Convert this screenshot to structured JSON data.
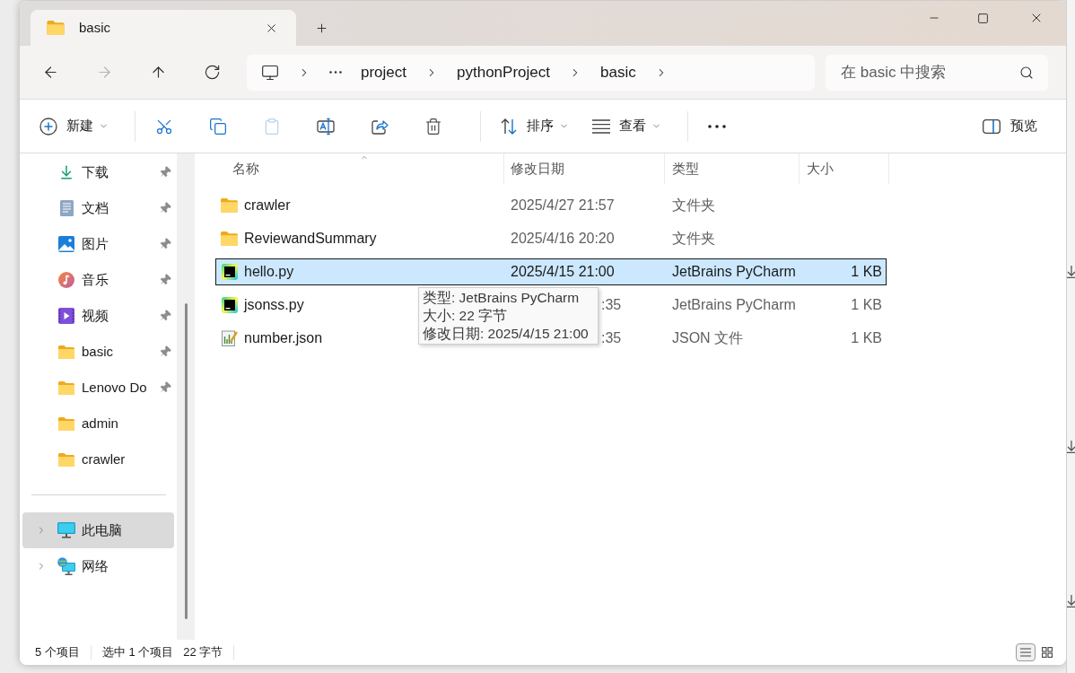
{
  "tabs": [
    {
      "label": "basic",
      "selected": true
    }
  ],
  "nav_buttons": [
    {
      "kind": "back",
      "disabled": false
    },
    {
      "kind": "forward",
      "disabled": true
    },
    {
      "kind": "up",
      "disabled": false
    },
    {
      "kind": "refresh",
      "disabled": false
    }
  ],
  "address_bar": {
    "crumbs": [
      "project",
      "pythonProject",
      "basic"
    ]
  },
  "search": {
    "placeholder": "在 basic 中搜索"
  },
  "toolbar": {
    "items": [
      {
        "kind": "new",
        "label": "新建",
        "disabled": false
      },
      {
        "kind": "separator"
      },
      {
        "kind": "cut",
        "disabled": false
      },
      {
        "kind": "copy",
        "disabled": false
      },
      {
        "kind": "paste",
        "disabled": true
      },
      {
        "kind": "rename",
        "disabled": false
      },
      {
        "kind": "share",
        "disabled": false
      },
      {
        "kind": "delete",
        "disabled": false
      },
      {
        "kind": "separator"
      },
      {
        "kind": "sort",
        "label": "排序",
        "disabled": false
      },
      {
        "kind": "view",
        "label": "查看",
        "disabled": false
      },
      {
        "kind": "separator"
      },
      {
        "kind": "more",
        "disabled": false
      }
    ],
    "preview": {
      "label": "预览"
    }
  },
  "sidebar": {
    "quick_access": [
      {
        "kind": "downloads",
        "label": "下载",
        "pinned": true,
        "selected": false
      },
      {
        "kind": "documents",
        "label": "文档",
        "pinned": true,
        "selected": false
      },
      {
        "kind": "pictures",
        "label": "图片",
        "pinned": true,
        "selected": false
      },
      {
        "kind": "music",
        "label": "音乐",
        "pinned": true,
        "selected": false
      },
      {
        "kind": "videos",
        "label": "视频",
        "pinned": true,
        "selected": false
      },
      {
        "kind": "folder",
        "label": "basic",
        "pinned": true,
        "selected": false
      },
      {
        "kind": "folder",
        "label": "Lenovo Do",
        "pinned": true,
        "selected": false
      },
      {
        "kind": "folder",
        "label": "admin",
        "pinned": false,
        "selected": false
      },
      {
        "kind": "folder",
        "label": "crawler",
        "pinned": false,
        "selected": false
      }
    ],
    "locations": [
      {
        "kind": "pc",
        "label": "此电脑",
        "selected": true
      },
      {
        "kind": "network",
        "label": "网络",
        "selected": false
      }
    ]
  },
  "table": {
    "columns": [
      {
        "label": "名称",
        "sorted": true
      },
      {
        "label": "修改日期",
        "sorted": false
      },
      {
        "label": "类型",
        "sorted": false
      },
      {
        "label": "大小",
        "sorted": false
      }
    ],
    "rows": [
      {
        "kind": "folder",
        "name": "crawler",
        "modified": "2025/4/27 21:57",
        "modified_partly_hidden": false,
        "type": "文件夹",
        "selected": false
      },
      {
        "kind": "folder",
        "name": "ReviewandSummary",
        "modified": "2025/4/16 20:20",
        "modified_partly_hidden": false,
        "type": "文件夹",
        "selected": false
      },
      {
        "kind": "pycharm",
        "name": "hello.py",
        "modified": "2025/4/15 21:00",
        "modified_partly_hidden": false,
        "type": "JetBrains PyCharm",
        "size": "1 KB",
        "selected": true
      },
      {
        "kind": "pycharm",
        "name": "jsonss.py",
        "modified": ":35",
        "modified_partly_hidden": true,
        "type": "JetBrains PyCharm",
        "size": "1 KB",
        "selected": false
      },
      {
        "kind": "json",
        "name": "number.json",
        "modified": ":35",
        "modified_partly_hidden": true,
        "type": "JSON 文件",
        "size": "1 KB",
        "selected": false
      }
    ]
  },
  "tooltip": {
    "lines": [
      "类型: JetBrains PyCharm",
      "大小: 22 字节",
      "修改日期: 2025/4/15 21:00"
    ]
  },
  "status_bar": {
    "texts": [
      "5 个项目",
      "选中 1 个项目",
      "22 字节"
    ],
    "views": [
      {
        "kind": "details",
        "selected": true
      },
      {
        "kind": "tiles",
        "selected": false
      }
    ]
  }
}
